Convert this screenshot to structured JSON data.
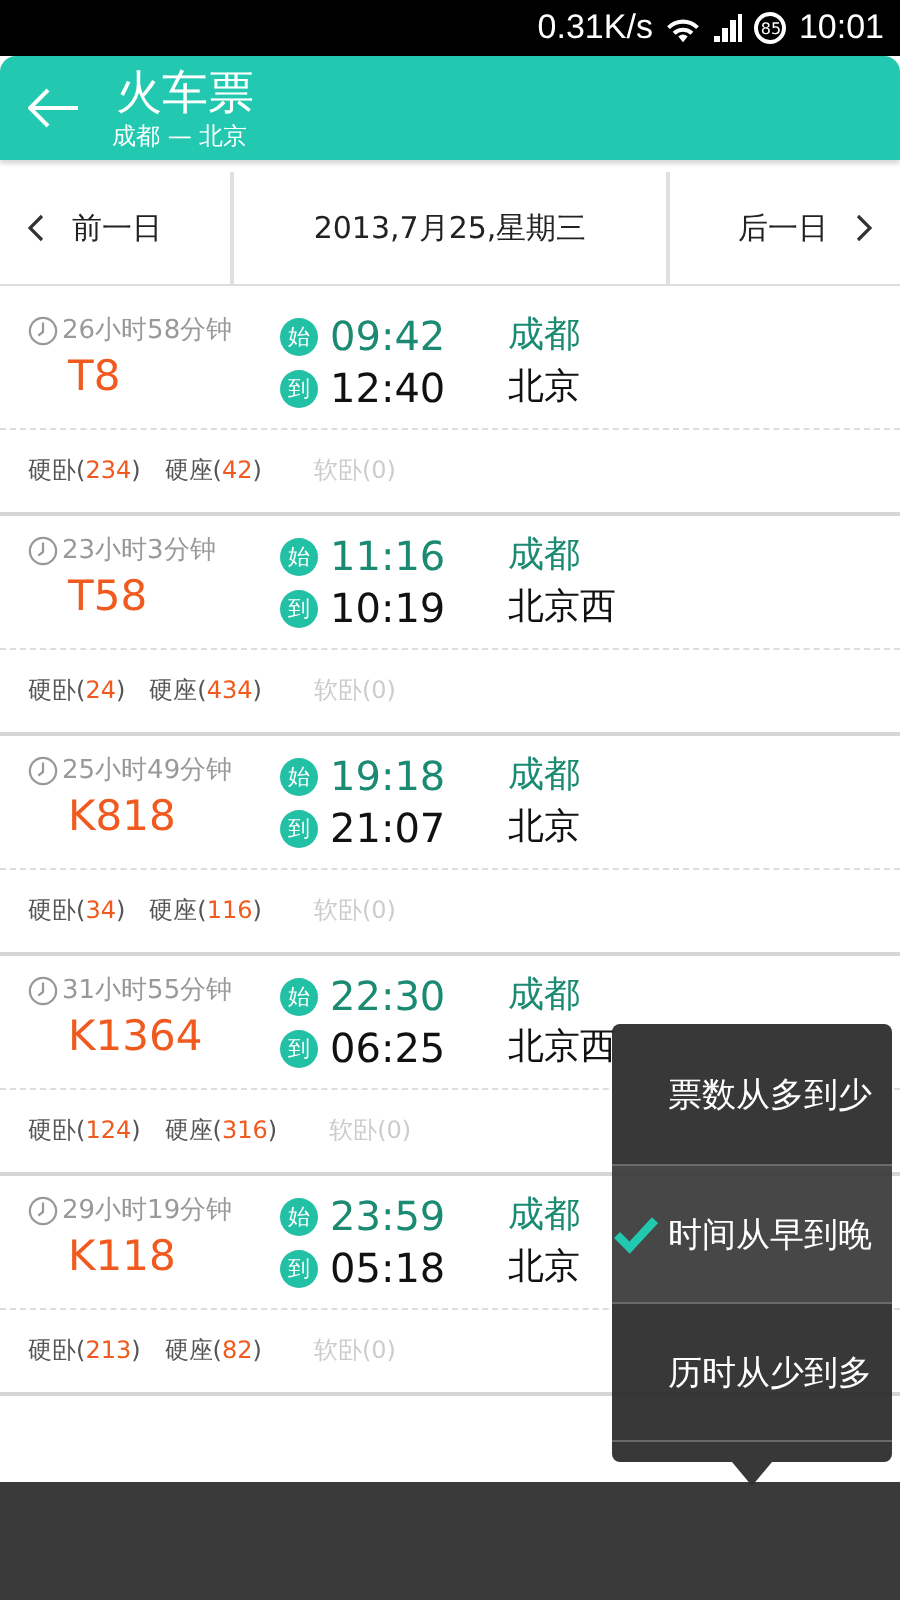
{
  "status_bar": {
    "network_speed": "0.31K/s",
    "battery": "85",
    "time": "10:01"
  },
  "header": {
    "title": "火车票",
    "route": "成都 — 北京"
  },
  "date_nav": {
    "prev": "前一日",
    "date": "2013,7月25,星期三",
    "next": "后一日"
  },
  "trains": [
    {
      "duration": "26小时58分钟",
      "number": "T8",
      "depart_badge": "始",
      "depart_time": "09:42",
      "arrive_badge": "到",
      "arrive_time": "12:40",
      "from": "成都",
      "to": "北京",
      "seats": [
        {
          "prefix": "硬卧(",
          "count": "234",
          "suffix": ")",
          "available": true
        },
        {
          "prefix": "硬座(",
          "count": "42",
          "suffix": ")",
          "available": true
        },
        {
          "prefix": "软卧(",
          "count": "0",
          "suffix": ")",
          "available": false
        }
      ]
    },
    {
      "duration": "23小时3分钟",
      "number": "T58",
      "depart_badge": "始",
      "depart_time": "11:16",
      "arrive_badge": "到",
      "arrive_time": "10:19",
      "from": "成都",
      "to": "北京西",
      "seats": [
        {
          "prefix": "硬卧(",
          "count": "24",
          "suffix": ")",
          "available": true
        },
        {
          "prefix": "硬座(",
          "count": "434",
          "suffix": ")",
          "available": true
        },
        {
          "prefix": "软卧(",
          "count": "0",
          "suffix": ")",
          "available": false
        }
      ]
    },
    {
      "duration": "25小时49分钟",
      "number": "K818",
      "depart_badge": "始",
      "depart_time": "19:18",
      "arrive_badge": "到",
      "arrive_time": "21:07",
      "from": "成都",
      "to": "北京",
      "seats": [
        {
          "prefix": "硬卧(",
          "count": "34",
          "suffix": ")",
          "available": true
        },
        {
          "prefix": "硬座(",
          "count": "116",
          "suffix": ")",
          "available": true
        },
        {
          "prefix": "软卧(",
          "count": "0",
          "suffix": ")",
          "available": false
        }
      ]
    },
    {
      "duration": "31小时55分钟",
      "number": "K1364",
      "depart_badge": "始",
      "depart_time": "22:30",
      "arrive_badge": "到",
      "arrive_time": "06:25",
      "from": "成都",
      "to": "北京西",
      "seats": [
        {
          "prefix": "硬卧(",
          "count": "124",
          "suffix": ")",
          "available": true
        },
        {
          "prefix": "硬座(",
          "count": "316",
          "suffix": ")",
          "available": true
        },
        {
          "prefix": "软卧(",
          "count": "0",
          "suffix": ")",
          "available": false
        }
      ]
    },
    {
      "duration": "29小时19分钟",
      "number": "K118",
      "depart_badge": "始",
      "depart_time": "23:59",
      "arrive_badge": "到",
      "arrive_time": "05:18",
      "from": "成都",
      "to": "北京",
      "seats": [
        {
          "prefix": "硬卧(",
          "count": "213",
          "suffix": ")",
          "available": true
        },
        {
          "prefix": "硬座(",
          "count": "82",
          "suffix": ")",
          "available": true
        },
        {
          "prefix": "软卧(",
          "count": "0",
          "suffix": ")",
          "available": false
        }
      ]
    }
  ],
  "sort_menu": {
    "items": [
      {
        "label": "票数从多到少",
        "selected": false
      },
      {
        "label": "时间从早到晚",
        "selected": true
      },
      {
        "label": "历时从少到多",
        "selected": false
      }
    ]
  }
}
